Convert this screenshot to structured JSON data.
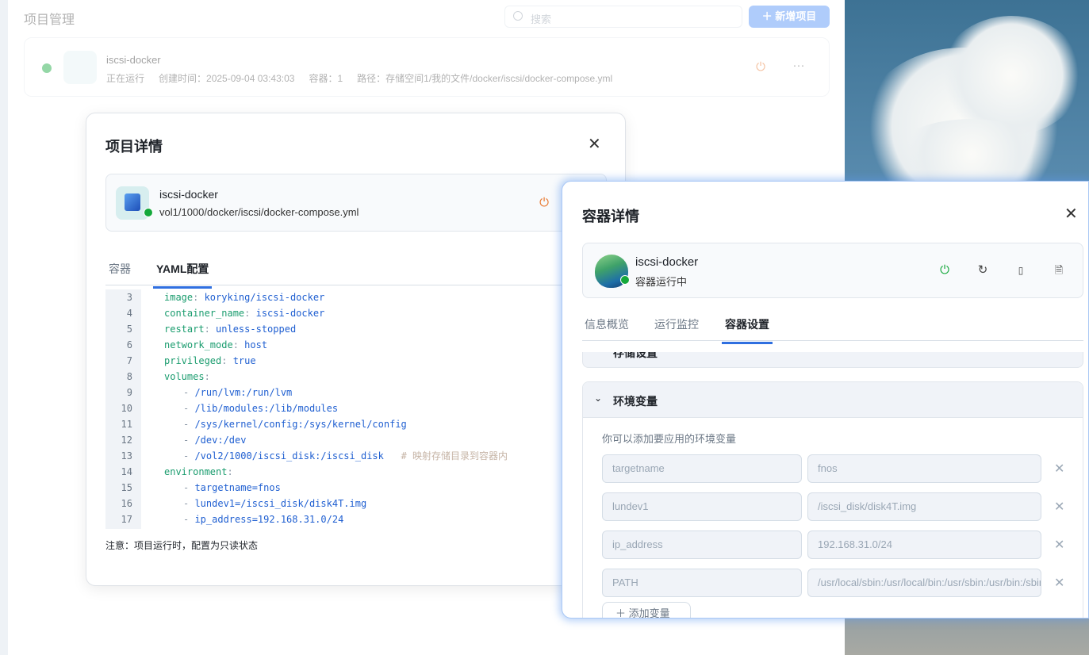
{
  "page": {
    "title": "项目管理",
    "search_placeholder": "搜索",
    "add_button": "新增项目"
  },
  "project_card": {
    "name": "iscsi-docker",
    "status": "正在运行",
    "created": "创建时间：2025-09-04 03:43:03",
    "containers": "容器：1",
    "path": "路径：存储空间1/我的文件/docker/iscsi/docker-compose.yml",
    "more": "···"
  },
  "project_dialog": {
    "title": "项目详情",
    "name": "iscsi-docker",
    "path": "vol1/1000/docker/iscsi/docker-compose.yml",
    "tabs": [
      "容器",
      "YAML配置"
    ],
    "active_tab": "YAML配置",
    "code": [
      {
        "n": "3",
        "indent": "",
        "key": "image",
        "val": "koryking/iscsi-docker"
      },
      {
        "n": "4",
        "indent": "",
        "key": "container_name",
        "val": "iscsi-docker"
      },
      {
        "n": "5",
        "indent": "",
        "key": "restart",
        "val": "unless-stopped"
      },
      {
        "n": "6",
        "indent": "",
        "key": "network_mode",
        "val": "host"
      },
      {
        "n": "7",
        "indent": "",
        "key": "privileged",
        "val": "true"
      },
      {
        "n": "8",
        "indent": "",
        "key": "volumes",
        "val": ""
      },
      {
        "n": "9",
        "indent": "item",
        "key": "",
        "val": "/run/lvm:/run/lvm"
      },
      {
        "n": "10",
        "indent": "item",
        "key": "",
        "val": "/lib/modules:/lib/modules"
      },
      {
        "n": "11",
        "indent": "item",
        "key": "",
        "val": "/sys/kernel/config:/sys/kernel/config"
      },
      {
        "n": "12",
        "indent": "item",
        "key": "",
        "val": "/dev:/dev"
      },
      {
        "n": "13",
        "indent": "item",
        "key": "",
        "val": "/vol2/1000/iscsi_disk:/iscsi_disk",
        "comment": "# 映射存储目录到容器内"
      },
      {
        "n": "14",
        "indent": "",
        "key": "environment",
        "val": ""
      },
      {
        "n": "15",
        "indent": "item",
        "key": "",
        "val": "targetname=fnos"
      },
      {
        "n": "16",
        "indent": "item",
        "key": "",
        "val": "lundev1=/iscsi_disk/disk4T.img"
      },
      {
        "n": "17",
        "indent": "item",
        "key": "",
        "val": "ip_address=192.168.31.0/24"
      }
    ],
    "note": "注意：项目运行时，配置为只读状态"
  },
  "container_dialog": {
    "title": "容器详情",
    "name": "iscsi-docker",
    "status": "容器运行中",
    "tabs": [
      "信息概览",
      "运行监控",
      "容器设置"
    ],
    "active_tab": "容器设置",
    "collapsed_section": "存储设置",
    "env_section": "环境变量",
    "env_hint": "你可以添加要应用的环境变量",
    "env": [
      {
        "key": "targetname",
        "value": "fnos"
      },
      {
        "key": "lundev1",
        "value": "/iscsi_disk/disk4T.img"
      },
      {
        "key": "ip_address",
        "value": "192.168.31.0/24"
      },
      {
        "key": "PATH",
        "value": "/usr/local/sbin:/usr/local/bin:/usr/sbin:/usr/bin:/sbin:/bin"
      }
    ],
    "add_var": "添加变量"
  },
  "colors": {
    "accent": "#2f6fe0",
    "running": "#14a83b",
    "power_orange": "#e8772e"
  }
}
